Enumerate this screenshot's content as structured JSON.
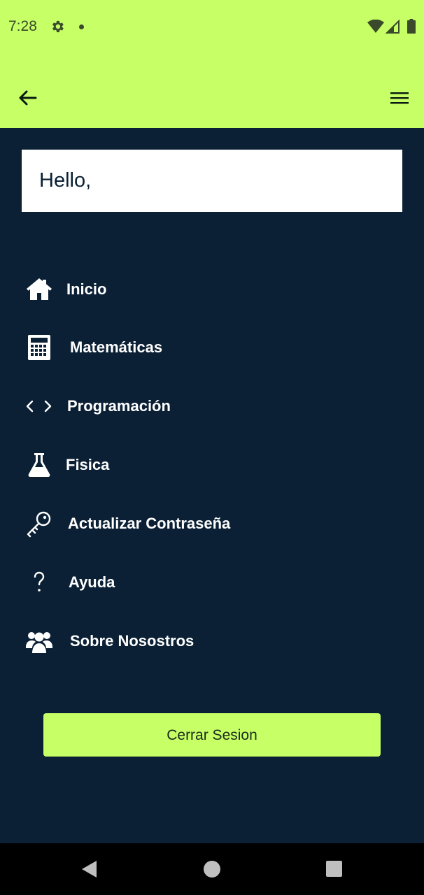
{
  "status_bar": {
    "time": "7:28",
    "icons": [
      "settings-icon",
      "notification-dot-icon",
      "wifi-icon",
      "signal-icon",
      "battery-icon"
    ]
  },
  "app_bar": {
    "back_icon": "arrow-left-icon",
    "menu_icon": "hamburger-menu-icon",
    "color": "#c6ff66"
  },
  "greeting": {
    "text": "Hello,"
  },
  "menu": {
    "items": [
      {
        "label": "Inicio",
        "icon": "home-icon"
      },
      {
        "label": "Matemáticas",
        "icon": "calculator-icon"
      },
      {
        "label": "Programación",
        "icon": "code-icon"
      },
      {
        "label": "Fisica",
        "icon": "flask-icon"
      },
      {
        "label": "Actualizar Contraseña",
        "icon": "key-icon"
      },
      {
        "label": "Ayuda",
        "icon": "question-icon"
      },
      {
        "label": "Sobre Nosostros",
        "icon": "users-icon"
      }
    ]
  },
  "logout": {
    "label": "Cerrar Sesion"
  },
  "colors": {
    "background": "#0b2035",
    "accent": "#c6ff66",
    "text_light": "#ffffff"
  },
  "system_nav": {
    "icons": [
      "nav-back-icon",
      "nav-home-icon",
      "nav-recents-icon"
    ]
  }
}
